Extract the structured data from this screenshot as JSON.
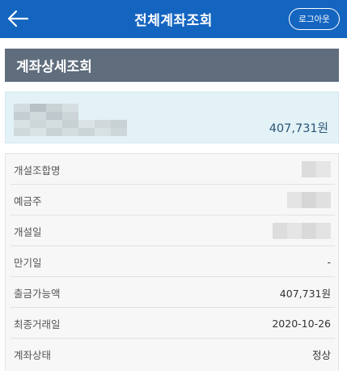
{
  "header": {
    "title": "전체계좌조회",
    "logout_label": "로그아웃",
    "back_icon": "arrow-left-icon"
  },
  "section": {
    "title": "계좌상세조회"
  },
  "account": {
    "balance": "407,731원"
  },
  "details": {
    "rows": [
      {
        "label": "개설조합명",
        "value": ""
      },
      {
        "label": "예금주",
        "value": ""
      },
      {
        "label": "개설일",
        "value": ""
      },
      {
        "label": "만기일",
        "value": "-"
      },
      {
        "label": "출금가능액",
        "value": "407,731원"
      },
      {
        "label": "최종거래일",
        "value": "2020-10-26"
      },
      {
        "label": "계좌상태",
        "value": "정상"
      }
    ]
  },
  "colors": {
    "header_bg": "#1465c0",
    "section_bg": "#5f6d7d",
    "card_bg": "#e2f2f7",
    "balance_text": "#2b5577"
  }
}
